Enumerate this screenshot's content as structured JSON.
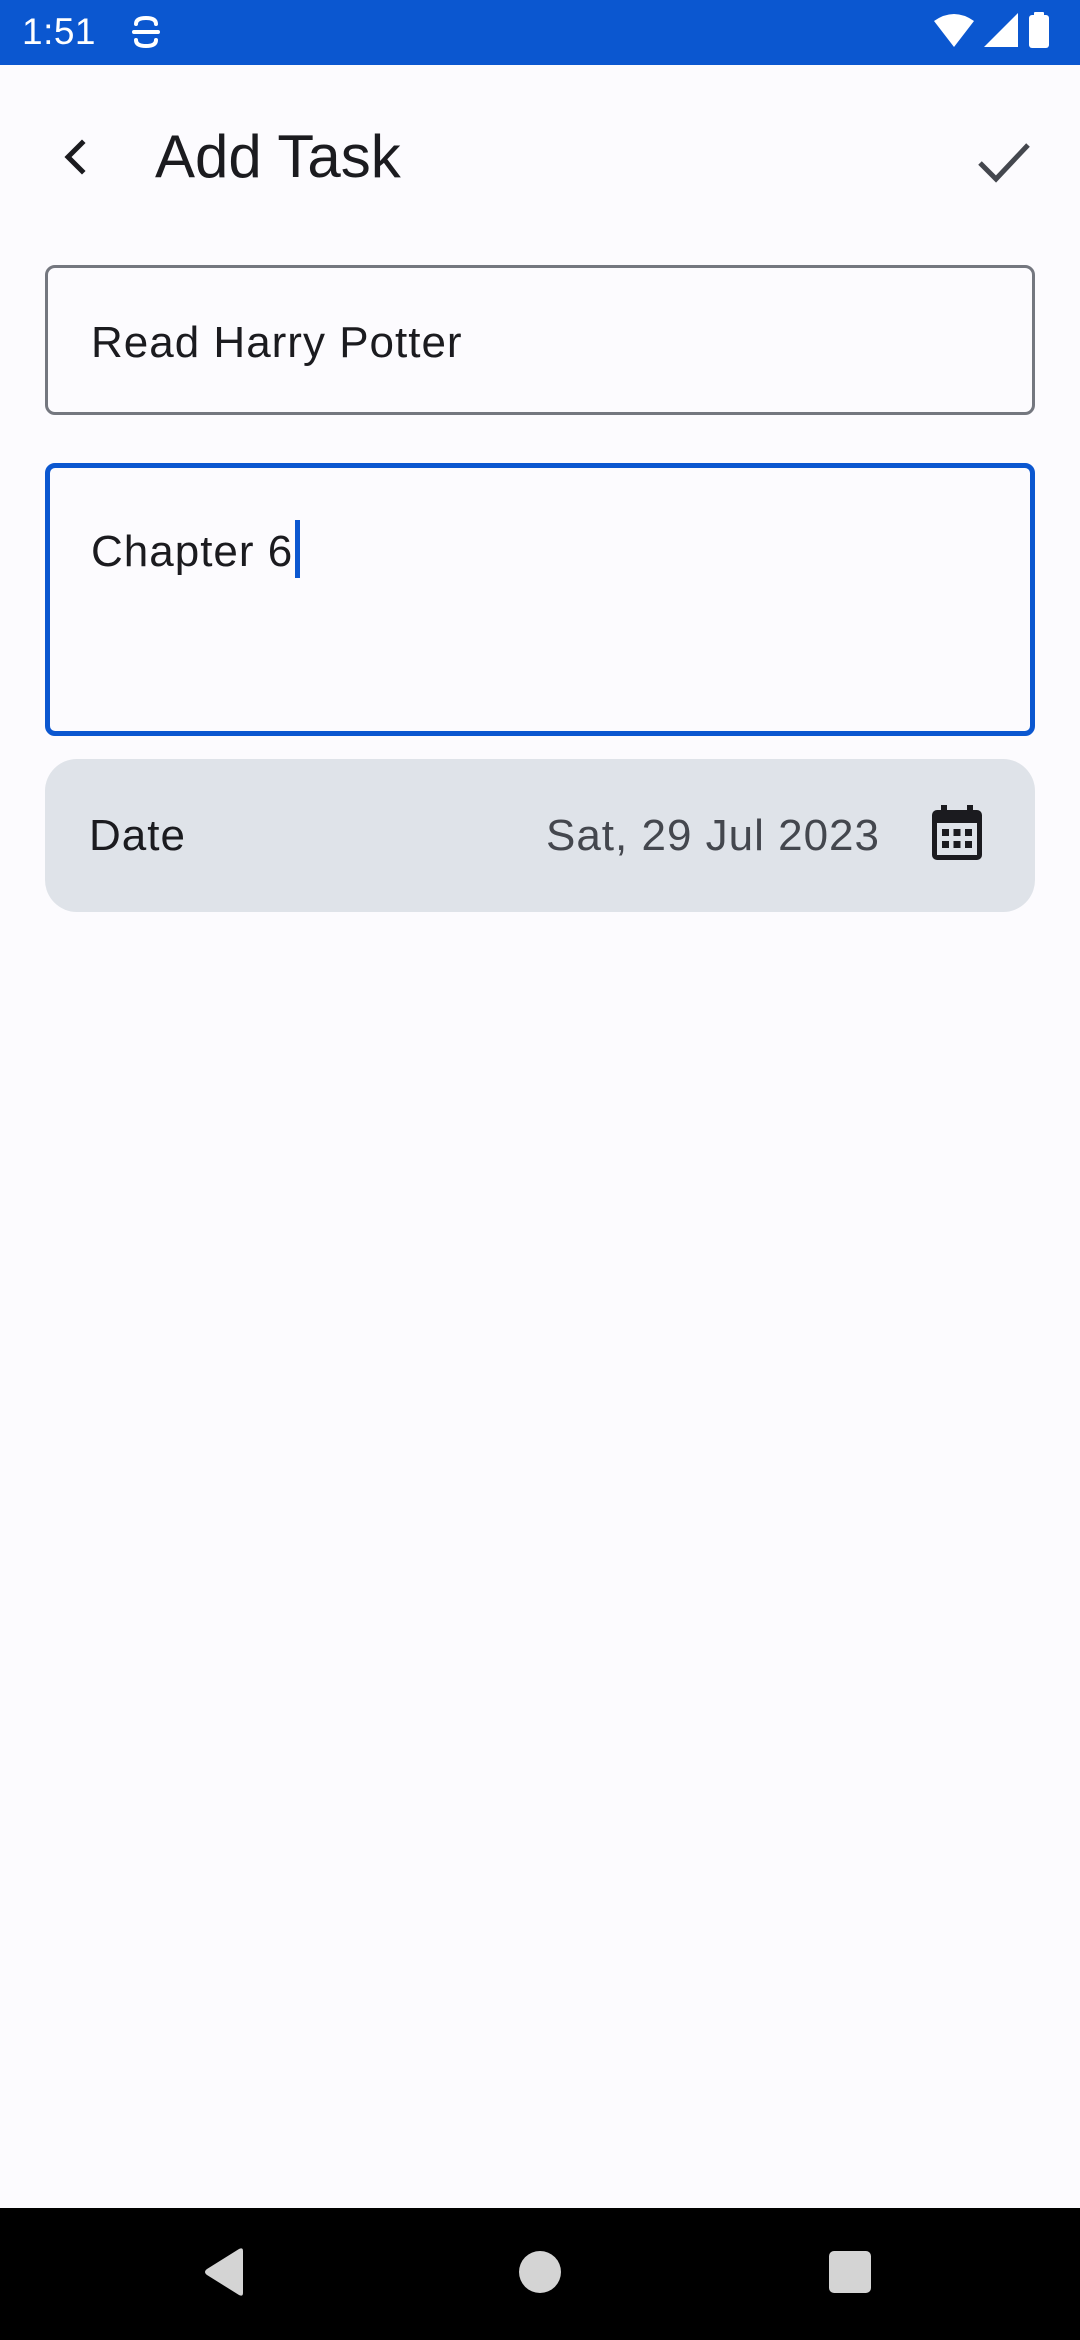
{
  "status_bar": {
    "time": "1:51",
    "icons": [
      "app-notification-icon",
      "wifi-icon",
      "cellular-signal-icon",
      "battery-icon"
    ],
    "background": "#0b57d0"
  },
  "app_bar": {
    "title": "Add Task",
    "back_icon": "chevron-left-icon",
    "save_icon": "check-icon"
  },
  "form": {
    "title_field": {
      "value": "Read Harry Potter"
    },
    "description_field": {
      "value": "Chapter 6",
      "focused": true
    },
    "date_field": {
      "label": "Date",
      "value": "Sat, 29 Jul 2023",
      "icon": "calendar-icon"
    }
  },
  "navigation_bar": {
    "buttons": [
      "back-triangle-icon",
      "home-circle-icon",
      "recents-square-icon"
    ]
  },
  "colors": {
    "accent": "#0b57d0",
    "background": "#fcfbfe",
    "field_outline": "#74777f",
    "date_field_bg": "#dfe3e9",
    "text_primary": "#1b1b1f",
    "text_secondary": "#44474e"
  }
}
